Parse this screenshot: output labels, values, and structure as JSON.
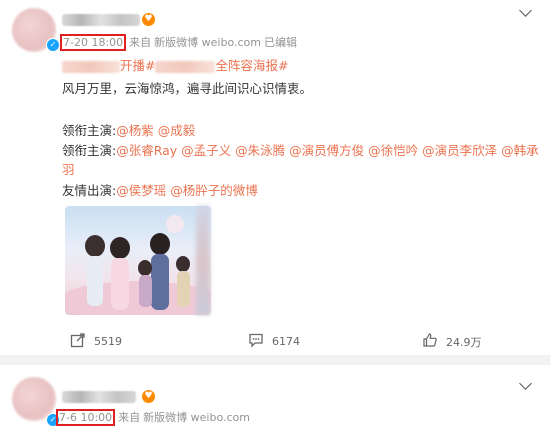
{
  "post1": {
    "author_verified_icon": "verified-icon",
    "meta": {
      "time": "7-20 18:00",
      "source_prefix": "来自",
      "source": "新版微博 weibo.com",
      "edited": "已编辑"
    },
    "hashtag_prefix": "开播#",
    "hashtag_suffix": "全阵容海报#",
    "body_line": "风月万里，云海惊鸿，遍寻此间识心识情衷。",
    "starring_label": "领衔主演:",
    "starring": [
      "@杨紫",
      "@成毅"
    ],
    "costarring_label": "领衔主演:",
    "costarring": [
      "@张睿Ray",
      "@孟子义",
      "@朱泳腾",
      "@演员傅方俊",
      "@徐恺吟",
      "@演员李欣泽",
      "@韩承"
    ],
    "costarring_wrap": "羽",
    "guest_label": "友情出演:",
    "guest": [
      "@侯梦瑶",
      "@杨肸子的微博"
    ],
    "actions": {
      "repost_icon": "share-icon",
      "repost_count": "5519",
      "comment_icon": "comment-icon",
      "comment_count": "6174",
      "like_icon": "thumbs-up-icon",
      "like_count": "24.9万"
    }
  },
  "post2": {
    "meta": {
      "time": "7-6 10:00",
      "source_prefix": "来自",
      "source": "新版微博 weibo.com"
    }
  },
  "colors": {
    "link": "#eb7350",
    "highlight": "#e02020",
    "muted": "#939393"
  }
}
